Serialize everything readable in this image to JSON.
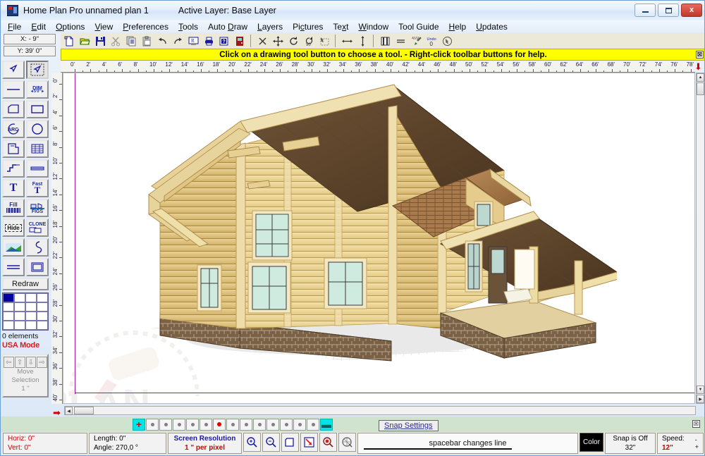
{
  "window": {
    "app_title": "Home Plan Pro  unnamed plan 1",
    "active_layer": "Active Layer: Base Layer",
    "minimize_label": "Minimize",
    "maximize_label": "Maximize",
    "close_label": "x"
  },
  "menu": {
    "items": [
      {
        "label": "File",
        "accel": "F"
      },
      {
        "label": "Edit",
        "accel": "E"
      },
      {
        "label": "Options",
        "accel": "O"
      },
      {
        "label": "View",
        "accel": "V"
      },
      {
        "label": "Preferences",
        "accel": "P"
      },
      {
        "label": "Tools",
        "accel": "T"
      },
      {
        "label": "Auto Draw",
        "accel": "D"
      },
      {
        "label": "Layers",
        "accel": "L"
      },
      {
        "label": "Pictures",
        "accel": "c"
      },
      {
        "label": "Text",
        "accel": "x"
      },
      {
        "label": "Window",
        "accel": "W"
      },
      {
        "label": "Tool Guide",
        "accel": ""
      },
      {
        "label": "Help",
        "accel": "H"
      },
      {
        "label": "Updates",
        "accel": "U"
      }
    ]
  },
  "toolbar": {
    "buttons": [
      {
        "name": "new-icon",
        "tip": "New"
      },
      {
        "name": "open-folder-icon",
        "tip": "Open"
      },
      {
        "name": "save-disk-icon",
        "tip": "Save"
      },
      {
        "name": "cut-scissors-icon",
        "tip": "Cut"
      },
      {
        "name": "copy-icon",
        "tip": "Copy"
      },
      {
        "name": "paste-clipboard-icon",
        "tip": "Paste"
      },
      {
        "name": "undo-arrow-icon",
        "tip": "Undo"
      },
      {
        "name": "redo-arrow-icon",
        "tip": "Redo"
      },
      {
        "name": "print-preview-icon",
        "tip": "Print Preview"
      },
      {
        "name": "printer-icon",
        "tip": "Print"
      },
      {
        "name": "help-question-icon",
        "tip": "Help"
      },
      {
        "name": "exit-door-icon",
        "tip": "Exit"
      },
      {
        "name": "delete-x-icon",
        "tip": "Delete"
      },
      {
        "name": "move-cross-icon",
        "tip": "Move"
      },
      {
        "name": "rotate-icon",
        "tip": "Rotate"
      },
      {
        "name": "rotate-90-icon",
        "tip": "Rotate 90"
      },
      {
        "name": "select-dashed-icon",
        "tip": "Select"
      },
      {
        "name": "horizontal-arrows-icon",
        "tip": "Mirror Horizontal"
      },
      {
        "name": "vertical-arrows-icon",
        "tip": "Mirror Vertical"
      },
      {
        "name": "columns-icon",
        "tip": "Columns"
      },
      {
        "name": "lines-icon",
        "tip": "Lines"
      },
      {
        "name": "paint-icon",
        "tip": "Paint"
      },
      {
        "name": "undo-zero-icon",
        "tip": "Undo 0",
        "label": "Undo"
      },
      {
        "name": "reselect-icon",
        "tip": "Reselect"
      }
    ]
  },
  "hint": {
    "message": "Click on a drawing tool button to choose a tool.  -  Right-click toolbar buttons for help.",
    "close_glyph": "☒"
  },
  "coords": {
    "x_label": "X: - 9\"",
    "y_label": "Y: 39' 0\""
  },
  "palette": {
    "buttons": [
      {
        "name": "pointer-select-icon",
        "label": ""
      },
      {
        "name": "pointer-marquee-icon",
        "label": ""
      },
      {
        "name": "line-icon",
        "label": ""
      },
      {
        "name": "dimension-icon",
        "label": "DIM",
        "sub": "5'-0\""
      },
      {
        "name": "polygon-icon",
        "label": ""
      },
      {
        "name": "rectangle-icon",
        "label": ""
      },
      {
        "name": "arc-icon",
        "label": "ARC"
      },
      {
        "name": "circle-icon",
        "label": ""
      },
      {
        "name": "wall-icon",
        "label": ""
      },
      {
        "name": "window-grid-icon",
        "label": ""
      },
      {
        "name": "stairs-icon",
        "label": ""
      },
      {
        "name": "door-icon",
        "label": ""
      },
      {
        "name": "text-icon",
        "label": "T"
      },
      {
        "name": "fast-text-icon",
        "label": "T",
        "sub": "Fast"
      },
      {
        "name": "fill-icon",
        "label": "Fill"
      },
      {
        "name": "figures-icon",
        "label": "FIGS"
      },
      {
        "name": "hide-icon",
        "label": "Hide"
      },
      {
        "name": "clone-icon",
        "label": "CLONE"
      },
      {
        "name": "gradient-icon",
        "label": ""
      },
      {
        "name": "curve-icon",
        "label": ""
      },
      {
        "name": "double-line-icon",
        "label": ""
      },
      {
        "name": "square-outline-icon",
        "label": ""
      }
    ],
    "redraw_label": "Redraw",
    "elements_label": "0 elements",
    "mode_label": "USA Mode",
    "move_label_1": "Move",
    "move_label_2": "Selection",
    "move_label_3": "1 \"",
    "move_arrows": [
      "⇦",
      "⇧",
      "⇩",
      "⇨"
    ],
    "swatch_selected_color": "#0000a0"
  },
  "rulers": {
    "h_ticks": [
      "0'",
      "2'",
      "4'",
      "6'",
      "8'",
      "10'",
      "12'",
      "14'",
      "16'",
      "18'",
      "20'",
      "22'",
      "24'",
      "26'",
      "28'",
      "30'",
      "32'",
      "34'",
      "36'",
      "38'",
      "40'",
      "42'",
      "44'",
      "46'",
      "48'",
      "50'",
      "52'",
      "54'",
      "56'",
      "58'",
      "60'",
      "62'",
      "64'",
      "66'",
      "68'",
      "70'",
      "72'",
      "74'",
      "76'",
      "78'"
    ],
    "v_ticks": [
      "0'",
      "2'",
      "4'",
      "6'",
      "8'",
      "10'",
      "12'",
      "14'",
      "16'",
      "18'",
      "20'",
      "22'",
      "24'",
      "26'",
      "28'",
      "30'",
      "32'",
      "34'",
      "36'",
      "38'",
      "40'"
    ]
  },
  "canvas": {
    "watermark_text": "PLAN",
    "drawing_title": "Log cabin house 3D rendering"
  },
  "dotbar": {
    "plus_glyph": "✚",
    "minus_glyph": "━",
    "dot_count": 13,
    "active_dot_index": 5,
    "snap_settings_label": "Snap Settings",
    "close_glyph": "☒"
  },
  "status": {
    "horiz_label": "Horiz: 0\"",
    "vert_label": "Vert: 0\"",
    "length_label": "Length:  0\"",
    "angle_label": "Angle:  270,0 °",
    "screen_resolution_label": "Screen Resolution",
    "screen_resolution_value": "1 \" per pixel",
    "zoom_buttons": [
      {
        "name": "zoom-in-icon"
      },
      {
        "name": "zoom-out-icon"
      },
      {
        "name": "fit-page-icon"
      },
      {
        "name": "zoom-selection-icon"
      },
      {
        "name": "zoom-previous-icon"
      },
      {
        "name": "pan-globe-icon"
      }
    ],
    "message": "spacebar changes line",
    "color_label": "Color",
    "snap_label": "Snap is Off",
    "snap_value": "32\"",
    "speed_label": "Speed:",
    "speed_value": "12\"",
    "spin_up": "-",
    "spin_down": "+"
  }
}
